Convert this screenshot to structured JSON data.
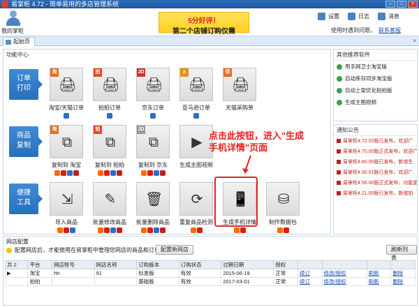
{
  "window": {
    "title": "易掌柜 4.72 - 简单易用的多店管理系统"
  },
  "header": {
    "my_shop": "我的掌柜",
    "promo_line1": "5分好评！",
    "promo_line2": "第二个店铺订购仅需",
    "tools": [
      {
        "label": "设置",
        "icon": "gear-icon"
      },
      {
        "label": "日志",
        "icon": "log-icon"
      },
      {
        "label": "消息",
        "icon": "message-icon"
      }
    ],
    "login_text": "使用时遇到问题，",
    "login_link": "联系客服"
  },
  "tabs": {
    "home": "起始页"
  },
  "func_center": {
    "title": "功能中心",
    "rows": [
      {
        "label": "订单\n打印",
        "items": [
          {
            "label": "淘宝/天猫订单",
            "badge": "淘",
            "glyph": "🖨"
          },
          {
            "label": "拍拍订单",
            "badge": "拍",
            "glyph": "🖨"
          },
          {
            "label": "京东订单",
            "badge": "JD",
            "glyph": "🖨"
          },
          {
            "label": "亚马逊订单",
            "badge": "a",
            "glyph": "🖨"
          },
          {
            "label": "天猫采购单",
            "badge": "供",
            "glyph": "🖨"
          }
        ]
      },
      {
        "label": "商品\n复制",
        "items": [
          {
            "label": "复制到 淘宝",
            "badge": "淘",
            "glyph": "⧉"
          },
          {
            "label": "复制到 拍拍",
            "badge": "拍",
            "glyph": "⧉"
          },
          {
            "label": "复制到 京东",
            "badge": "JD",
            "glyph": "⧉"
          },
          {
            "label": "生成主图视频",
            "badge": "",
            "glyph": "▶"
          }
        ]
      },
      {
        "label": "便捷\n工具",
        "items": [
          {
            "label": "导入商品",
            "badge": "",
            "glyph": "⇲"
          },
          {
            "label": "批量修改商品",
            "badge": "",
            "glyph": "✎"
          },
          {
            "label": "批量删除商品",
            "badge": "",
            "glyph": "🗑"
          },
          {
            "label": "重复商品检测",
            "badge": "",
            "glyph": "⟳"
          },
          {
            "label": "生成手机详情",
            "badge": "",
            "glyph": "📱"
          },
          {
            "label": "制作数据包",
            "badge": "",
            "glyph": "⛁"
          }
        ]
      }
    ],
    "annotation": "点击此按钮，进入\"生成\n手机详情\"页面"
  },
  "recommend": {
    "title": "其他推荐软件",
    "items": [
      "甩手网卫士淘宝版",
      "自动库存同步淘宝版",
      "自动上架优化拍拍版",
      "生成主图视频"
    ]
  },
  "notices": {
    "title": "通知公告",
    "items": [
      "易掌柜4.72.02版已发布，欢迎广",
      "易掌柜4.70.00版正式发布，欢迎广",
      "易掌柜4.60.00版已发布，新增生",
      "易掌柜4.50.01版已发布，欢迎广",
      "易掌柜4.50.00版正式发布，功能更",
      "易掌柜4.21.00版已发布，新增拍"
    ]
  },
  "store_config": {
    "title": "网店配置",
    "tip": "配置网店后，才能使用在易掌柜中管理您网店的商品和订单",
    "config_button": "配置新网店",
    "refresh_button": "刷新列表",
    "count_label": "共 2",
    "columns": [
      "平台",
      "网店账号",
      "网店名称",
      "订购版本",
      "订购状态",
      "过期日期",
      "授权",
      "",
      "",
      "",
      ""
    ],
    "rows": [
      [
        "淘宝",
        "hh",
        "91",
        "标准版",
        "有效",
        "2015-06-19",
        "正常",
        "续订",
        "修改/授权",
        "刷新",
        "删除"
      ],
      [
        "拍拍",
        "",
        "",
        "基础版",
        "有效",
        "2017-03-01",
        "正常",
        "续订",
        "修改/授权",
        "刷新",
        "删除"
      ]
    ]
  }
}
